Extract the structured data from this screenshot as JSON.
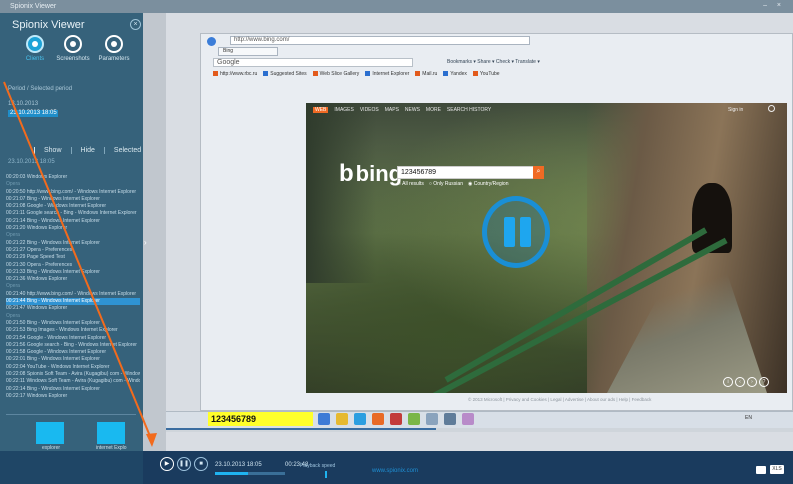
{
  "app": {
    "window_title": "Spionix Viewer",
    "panel_title": "Spionix Viewer",
    "close_symbol": "×"
  },
  "modes": [
    {
      "label": "Clients",
      "icon": "clients-icon",
      "active": true
    },
    {
      "label": "Screenshots",
      "icon": "screenshots-icon",
      "active": false
    },
    {
      "label": "Parameters",
      "icon": "parameters-icon",
      "active": false
    }
  ],
  "sessions": {
    "header": "Period / Selected period",
    "date": "13.10.2013",
    "selected": "23.10.2013 18:05"
  },
  "filter_buttons": [
    "Show",
    "Hide",
    "Selected"
  ],
  "events": {
    "header": "23.10.2013 18:05",
    "items": [
      {
        "text": "00:20:03  Windows Explorer",
        "type": "normal"
      },
      {
        "text": "Opera",
        "type": "group"
      },
      {
        "text": "00:20:50  http://www.bing.com/ - Windows Internet Explorer",
        "type": "normal"
      },
      {
        "text": "00:21:07  Bing - Windows Internet Explorer",
        "type": "normal"
      },
      {
        "text": "00:21:08  Google - Windows Internet Explorer",
        "type": "normal"
      },
      {
        "text": "00:21:11  Google search - Bing - Windows Internet Explorer",
        "type": "normal"
      },
      {
        "text": "00:21:14  Bing - Windows Internet Explorer",
        "type": "normal"
      },
      {
        "text": "00:21:20  Windows Explorer",
        "type": "normal"
      },
      {
        "text": "Opera",
        "type": "group"
      },
      {
        "text": "00:21:22  Bing - Windows Internet Explorer",
        "type": "normal"
      },
      {
        "text": "00:21:27  Opera - Preferences",
        "type": "normal"
      },
      {
        "text": "00:21:29  Page Speed Test",
        "type": "normal"
      },
      {
        "text": "00:21:30  Opera - Preferences",
        "type": "normal"
      },
      {
        "text": "00:21:33  Bing - Windows Internet Explorer",
        "type": "normal"
      },
      {
        "text": "00:21:36  Windows Explorer",
        "type": "normal"
      },
      {
        "text": "Opera",
        "type": "group"
      },
      {
        "text": "00:21:40  http://www.bing.com/ - Windows Internet Explorer",
        "type": "normal"
      },
      {
        "text": "00:21:44  Bing - Windows Internet Explorer",
        "type": "highlight"
      },
      {
        "text": "00:21:47  Windows Explorer",
        "type": "normal"
      },
      {
        "text": "Opera",
        "type": "group"
      },
      {
        "text": "00:21:50  Bing - Windows Internet Explorer",
        "type": "normal"
      },
      {
        "text": "00:21:53  Bing Images - Windows Internet Explorer",
        "type": "normal"
      },
      {
        "text": "00:21:54  Google - Windows Internet Explorer",
        "type": "normal"
      },
      {
        "text": "00:21:56  Google search - Bing - Windows Internet Explorer",
        "type": "normal"
      },
      {
        "text": "00:21:58  Google - Windows Internet Explorer",
        "type": "normal"
      },
      {
        "text": "00:22:01  Bing - Windows Internet Explorer",
        "type": "normal"
      },
      {
        "text": "00:22:04  YouTube - Windows Internet Explorer",
        "type": "normal"
      },
      {
        "text": "00:22:08  Spionix Soft Team - Avira (Kugagibu) com - Windows",
        "type": "normal"
      },
      {
        "text": "00:22:11  Windows Soft Team - Avira (Kugagibu) com - Windows",
        "type": "normal"
      },
      {
        "text": "00:22:14  Bing - Windows Internet Explorer",
        "type": "normal"
      },
      {
        "text": "00:22:17  Windows Explorer",
        "type": "normal"
      }
    ]
  },
  "stats": {
    "bars": [
      {
        "label": "explorer",
        "value": 0.62
      },
      {
        "label": "internet Explo",
        "value": 0.62
      }
    ]
  },
  "browser": {
    "url": "http://www.bing.com/",
    "tab_label": "Bing",
    "google_box": "Google",
    "toolbar_text": "Bookmarks ▾  Share ▾  Check ▾  Translate ▾",
    "favorites": [
      "http://www.rbc.ru",
      "Suggested Sites",
      "Web Slice Gallery",
      "Internet Explorer",
      "Mail.ru",
      "Yandex",
      "YouTube"
    ]
  },
  "bing": {
    "nav": [
      "WEB",
      "IMAGES",
      "VIDEOS",
      "MAPS",
      "NEWS",
      "MORE",
      "SEARCH HISTORY"
    ],
    "right_link": "Sign in",
    "logo": "bing",
    "query": "123456789",
    "search_symbol": "⌕",
    "radios": [
      "All results",
      "Only Russian",
      "Country/Region"
    ],
    "footer": "© 2013 Microsoft | Privacy and Cookies | Legal | Advertise | About our ads | Help | Feedback"
  },
  "taskbar": {
    "input": "123456789",
    "right": "EN"
  },
  "player": {
    "date": "23.10.2013 18:05",
    "time": "00:23:48",
    "speed_label": "Playback speed",
    "site": "www.spionix.com",
    "format_label": "XLS"
  },
  "colors": {
    "panel": "#36627b",
    "accent": "#19b9f0",
    "player": "#1a3b5e",
    "annotation": "#f26b1d",
    "highlight": "#ffff2a"
  }
}
